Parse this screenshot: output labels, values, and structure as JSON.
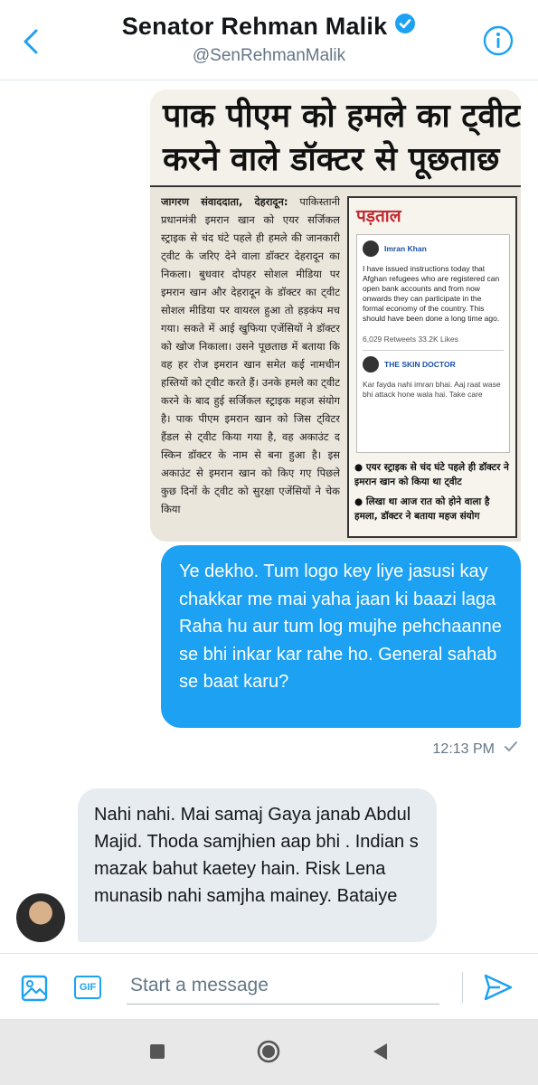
{
  "header": {
    "name": "Senator Rehman Malik",
    "handle": "@SenRehmanMalik",
    "verified_icon": "verified-badge-icon",
    "accent_color": "#1da1f2"
  },
  "newspaper": {
    "headline_line1": "पाक पीएम को हमले का ट्वीट",
    "headline_line2": "करने वाले डॉक्टर से पूछताछ",
    "byline": "जागरण संवाददाता, देहरादून:",
    "body": "पाकिस्तानी प्रधानमंत्री इमरान खान को एयर सर्जिकल स्ट्राइक से चंद घंटे पहले ही हमले की जानकारी ट्वीट के जरिए देने वाला डॉक्टर देहरादून का निकला। बुधवार दोपहर सोशल मीडिया पर इमरान खान और देहरादून के डॉक्टर का ट्वीट सोशल मीडिया पर वायरल हुआ तो हड़कंप मच गया। सकते में आई खुफिया एजेंसियों ने डॉक्टर को खोज निकाला। उसने पूछताछ में बताया कि वह हर रोज इमरान खान समेत कई नामचीन हस्तियों को ट्वीट करते हैं। उनके हमले का ट्वीट करने के बाद हुई सर्जिकल स्ट्राइक महज संयोग है। पाक पीएम इमरान खान को जिस ट्विटर हैंडल से ट्वीट किया गया है, वह अकाउंट द स्किन डॉक्टर के नाम से बना हुआ है। इस अकाउंट से इमरान खान को किए गए पिछले कुछ दिनों के ट्वीट को सुरक्षा एजेंसियों ने चेक किया",
    "box_title": "पड़ताल",
    "tweet_author": "Imran Khan",
    "tweet_text": "I have issued instructions today that Afghan refugees who are registered can open bank accounts and from now onwards they can participate in the formal economy of the country. This should have been done a long time ago.",
    "tweet_stats": "6,029 Retweets  33.2K Likes",
    "reply_author": "THE SKIN DOCTOR",
    "reply_text": "Kar fayda nahi imran bhai. Aaj raat wase bhi attack hone wala hai. Take care",
    "bullet1": "एयर स्ट्राइक से चंद घंटे पहले ही डॉक्टर ने इमरान खान को किया था ट्वीट",
    "bullet2": "लिखा था आज रात को होने वाला है हमला, डॉक्टर ने बताया महज संयोग"
  },
  "messages": {
    "outgoing_text": "Ye dekho. Tum logo key liye jasusi kay chakkar me mai yaha jaan ki baazi laga Raha hu aur tum log mujhe pehchaanne se bhi inkar kar rahe ho. General sahab se baat karu?",
    "outgoing_time": "12:13 PM",
    "incoming_text": "Nahi nahi. Mai samaj Gaya janab Abdul Majid. Thoda samjhien aap bhi . Indian s mazak bahut kaetey hain. Risk Lena munasib nahi samjha mainey. Bataiye"
  },
  "composer": {
    "placeholder": "Start a message",
    "gif_label": "GIF"
  }
}
